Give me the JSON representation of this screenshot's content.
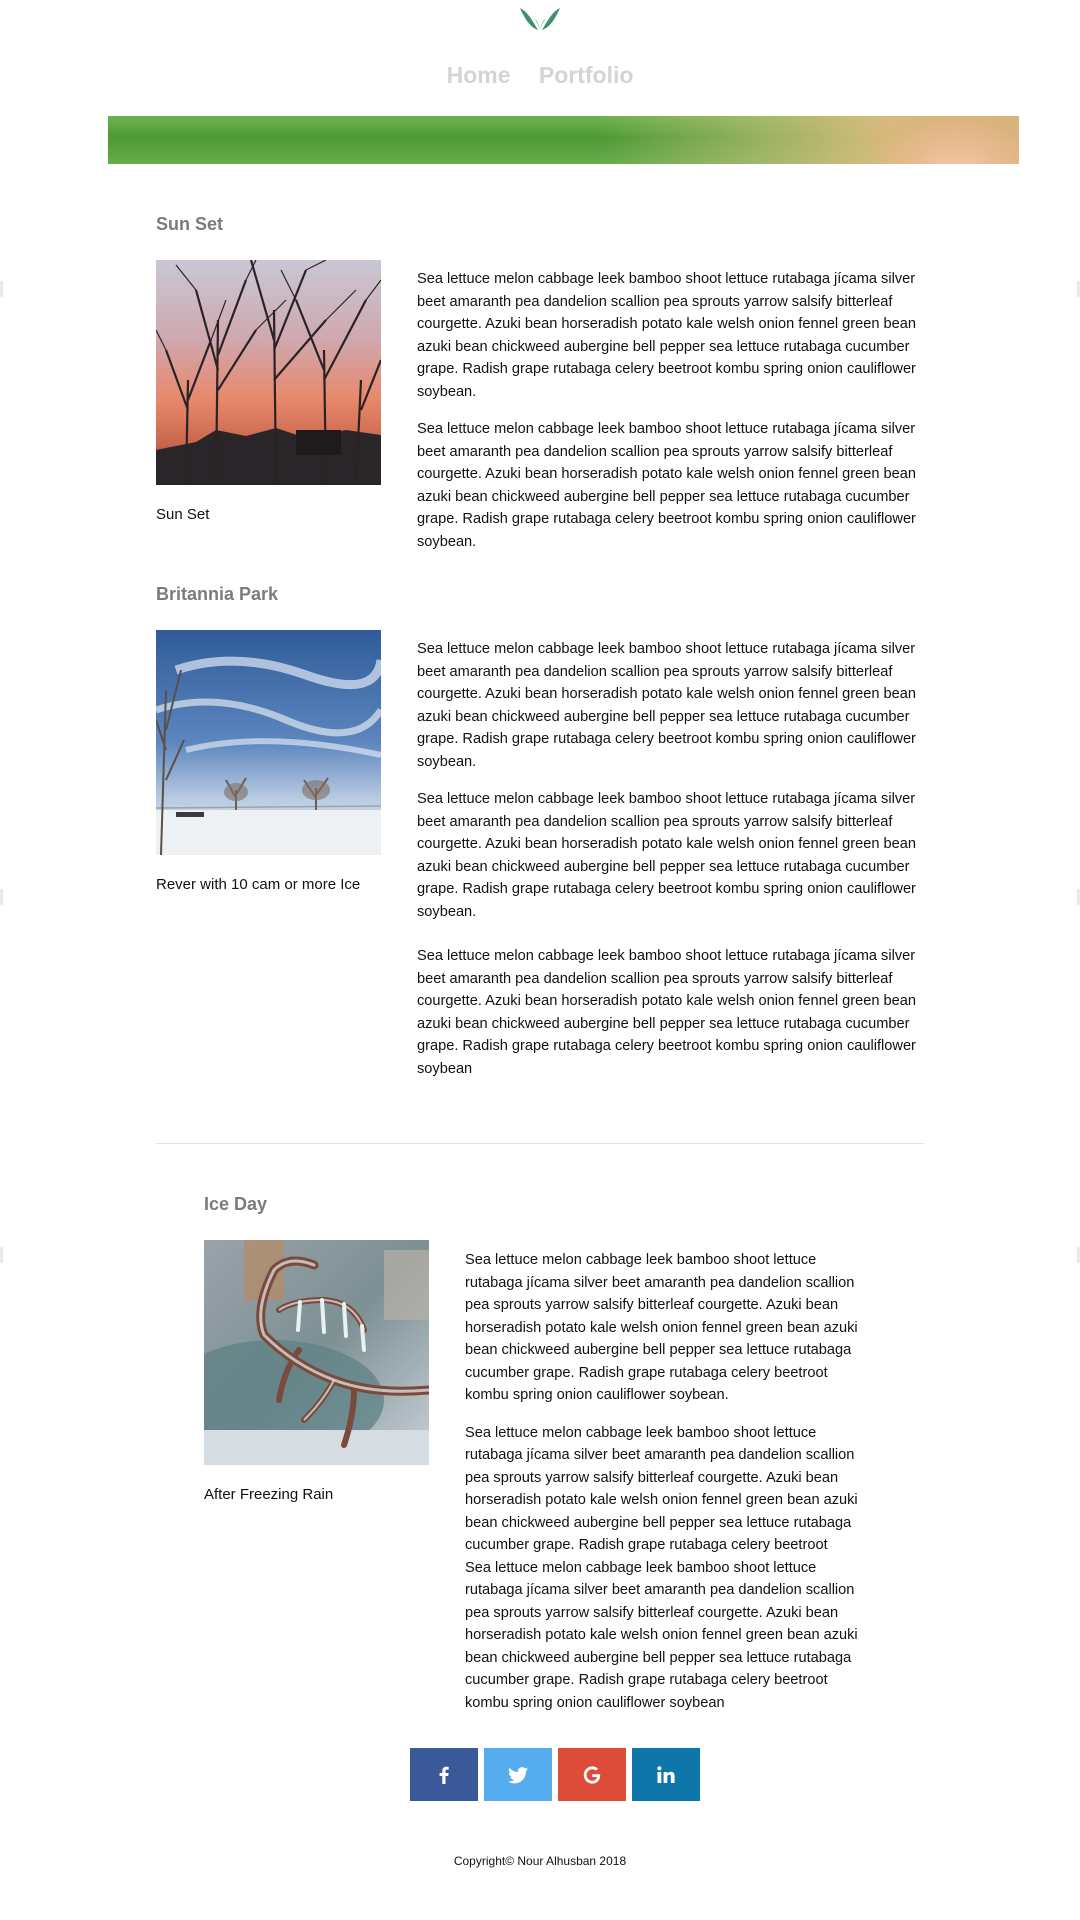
{
  "nav": {
    "items": [
      "Home",
      "Portfolio"
    ]
  },
  "sections": [
    {
      "title": "Sun Set",
      "caption": "Sun Set",
      "paragraphs": [
        "Sea lettuce melon cabbage leek bamboo shoot lettuce rutabaga jícama silver beet amaranth pea dandelion scallion pea sprouts yarrow salsify bitterleaf courgette. Azuki bean horseradish potato kale welsh onion fennel green bean azuki bean chickweed aubergine bell pepper sea lettuce rutabaga cucumber grape. Radish grape rutabaga celery beetroot kombu spring onion cauliflower soybean.",
        "Sea lettuce melon cabbage leek bamboo shoot lettuce rutabaga jícama silver beet amaranth pea dandelion scallion pea sprouts yarrow salsify bitterleaf courgette. Azuki bean horseradish potato kale welsh onion fennel green bean azuki bean chickweed aubergine bell pepper sea lettuce rutabaga cucumber grape. Radish grape rutabaga celery beetroot kombu spring onion cauliflower soybean."
      ]
    },
    {
      "title": "Britannia Park",
      "caption": "Rever with 10 cam or more Ice",
      "paragraphs": [
        "Sea lettuce melon cabbage leek bamboo shoot lettuce rutabaga jícama silver beet amaranth pea dandelion scallion pea sprouts yarrow salsify bitterleaf courgette. Azuki bean horseradish potato kale welsh onion fennel green bean azuki bean chickweed aubergine bell pepper sea lettuce rutabaga cucumber grape. Radish grape rutabaga celery beetroot kombu spring onion cauliflower soybean.",
        "Sea lettuce melon cabbage leek bamboo shoot lettuce rutabaga jícama silver beet amaranth pea dandelion scallion pea sprouts yarrow salsify bitterleaf courgette. Azuki bean horseradish potato kale welsh onion fennel green bean azuki bean chickweed aubergine bell pepper sea lettuce rutabaga cucumber grape. Radish grape rutabaga celery beetroot kombu spring onion cauliflower soybean.",
        "Sea lettuce melon cabbage leek bamboo shoot lettuce rutabaga jícama silver beet amaranth pea dandelion scallion pea sprouts yarrow salsify bitterleaf courgette. Azuki bean horseradish potato kale welsh onion fennel green bean azuki bean chickweed aubergine bell pepper sea lettuce rutabaga cucumber grape. Radish grape rutabaga celery beetroot kombu spring onion cauliflower soybean"
      ]
    },
    {
      "title": "Ice Day",
      "caption": "After Freezing Rain",
      "paragraphs": [
        "Sea lettuce melon cabbage leek bamboo shoot lettuce rutabaga jícama silver beet amaranth pea dandelion scallion pea sprouts yarrow salsify bitterleaf courgette. Azuki bean horseradish potato kale welsh onion fennel green bean azuki bean chickweed aubergine bell pepper sea lettuce rutabaga cucumber grape. Radish grape rutabaga celery beetroot kombu spring onion cauliflower soybean.",
        "Sea lettuce melon cabbage leek bamboo shoot lettuce rutabaga jícama silver beet amaranth pea dandelion scallion pea sprouts yarrow salsify bitterleaf courgette. Azuki bean horseradish potato kale welsh onion fennel green bean azuki bean chickweed aubergine bell pepper sea lettuce rutabaga cucumber grape. Radish grape rutabaga celery beetroot",
        "Sea lettuce melon cabbage leek bamboo shoot lettuce rutabaga jícama silver beet amaranth pea dandelion scallion pea sprouts yarrow salsify bitterleaf courgette. Azuki bean horseradish potato kale welsh onion fennel green bean azuki bean chickweed aubergine bell pepper sea lettuce rutabaga cucumber grape. Radish grape rutabaga celery beetroot kombu spring onion cauliflower soybean"
      ]
    }
  ],
  "social": [
    {
      "name": "facebook-icon",
      "glyph": "f",
      "color": "#3b5998"
    },
    {
      "name": "twitter-icon",
      "glyph": "bird",
      "color": "#55acee"
    },
    {
      "name": "google-icon",
      "glyph": "G",
      "color": "#dd4b39"
    },
    {
      "name": "linkedin-icon",
      "glyph": "in",
      "color": "#0e76a8"
    }
  ],
  "footer": {
    "copyright": "Copyright© Nour Alhusban 2018"
  },
  "colors": {
    "nav_text": "#d4d4d4",
    "heading_text": "#7b7b7b",
    "divider": "#e2e2e2"
  }
}
